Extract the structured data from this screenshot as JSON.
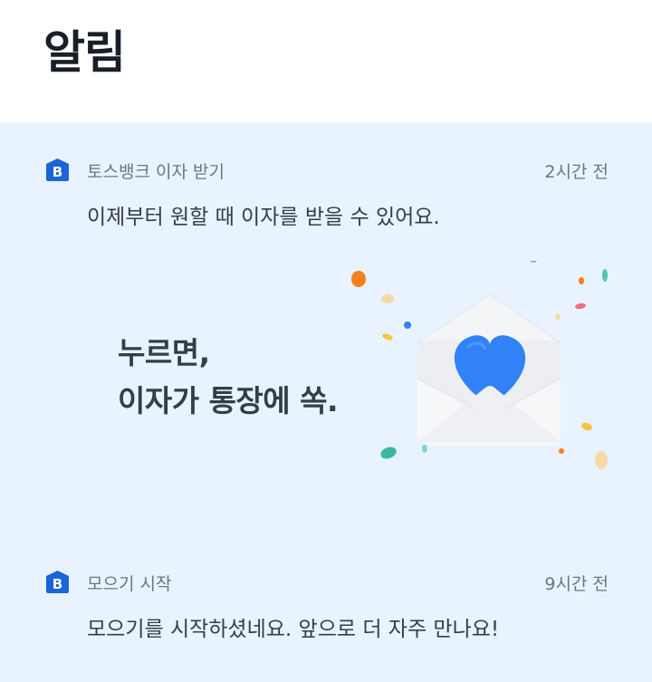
{
  "page": {
    "title": "알림"
  },
  "notifications": [
    {
      "icon": "toss-bank-icon",
      "source": "토스뱅크 이자 받기",
      "time": "2시간 전",
      "message": "이제부터 원할 때 이자를 받을 수 있어요.",
      "promo": {
        "line1": "누르면,",
        "line2": "이자가 통장에 쏙.",
        "art": "envelope-heart-icon",
        "colors": {
          "heart": "#3182f6",
          "envelope": "#eef0f3"
        }
      }
    },
    {
      "icon": "toss-bank-icon",
      "source": "모으기 시작",
      "time": "9시간 전",
      "message": "모으기를 시작하셨네요. 앞으로 더 자주 만나요!"
    }
  ],
  "colors": {
    "feed_background": "#e8f3ff",
    "brand_blue": "#1b64da",
    "title_text": "#191f28",
    "secondary_text": "#6b7684"
  }
}
